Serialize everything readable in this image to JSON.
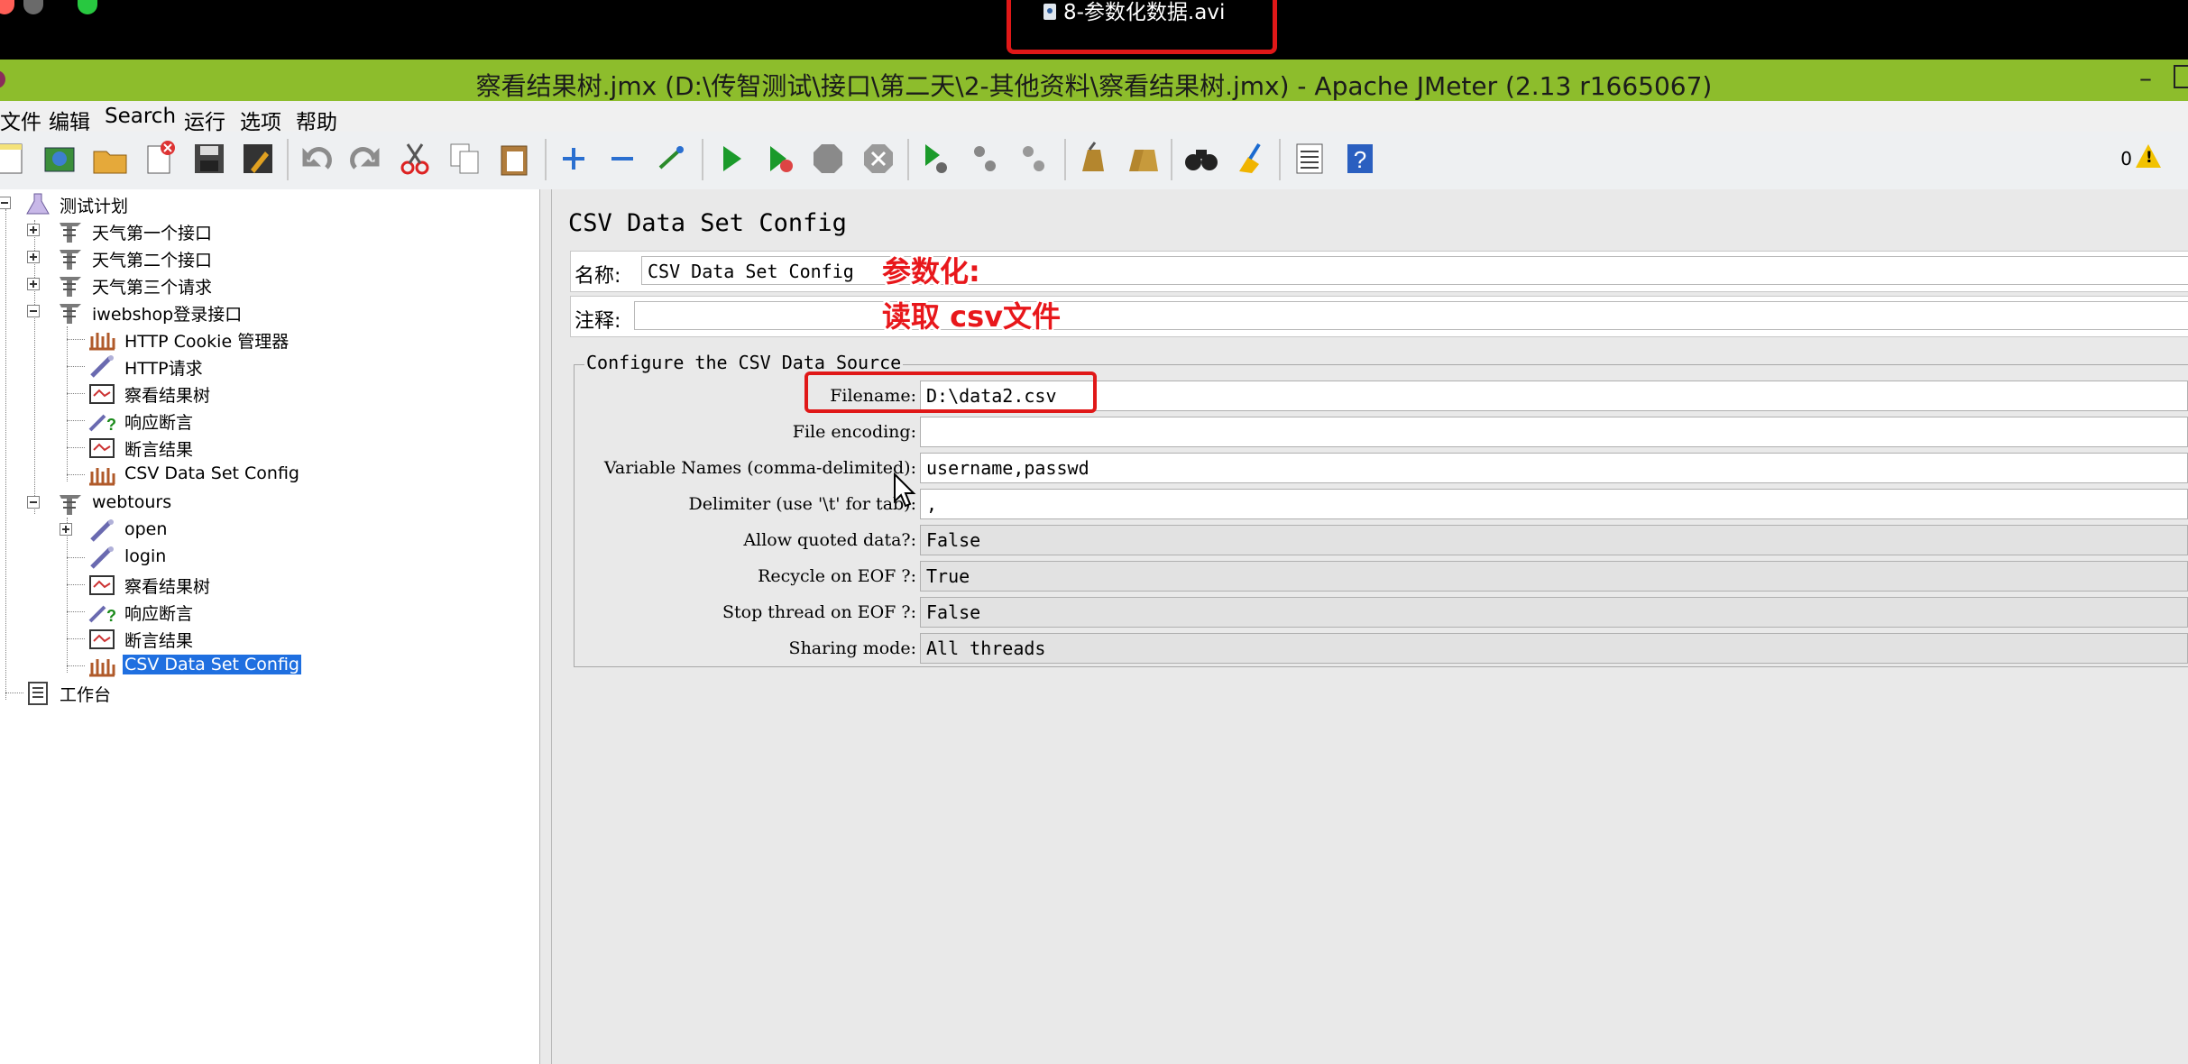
{
  "player": {
    "file_title": "8-参数化数据.avi"
  },
  "window": {
    "title": "察看结果树.jmx (D:\\传智测试\\接口\\第二天\\2-其他资料\\察看结果树.jmx) - Apache JMeter (2.13 r1665067)",
    "minimize": "–"
  },
  "menu": [
    "文件",
    "编辑",
    "Search",
    "运行",
    "选项",
    "帮助"
  ],
  "toolbar": {
    "icons": [
      "new-icon",
      "templates-icon",
      "open-icon",
      "close-icon",
      "save-icon",
      "save-as-icon",
      "undo-icon",
      "redo-icon",
      "cut-icon",
      "copy-icon",
      "paste-icon",
      "expand-icon",
      "collapse-icon",
      "toggle-icon",
      "start-icon",
      "start-no-pause-icon",
      "stop-icon",
      "shutdown-icon",
      "remote-start-icon",
      "remote-stop-icon",
      "remote-shutdown-icon",
      "clear-icon",
      "clear-all-icon",
      "search-icon",
      "reset-search-icon",
      "function-helper-icon",
      "help-icon"
    ],
    "warning_count": "0"
  },
  "tree": {
    "nodes": [
      {
        "label": "测试计划",
        "icon": "test-plan-icon"
      },
      {
        "label": "天气第一个接口",
        "icon": "thread-group-icon"
      },
      {
        "label": "天气第二个接口",
        "icon": "thread-group-icon"
      },
      {
        "label": "天气第三个请求",
        "icon": "thread-group-icon"
      },
      {
        "label": "iwebshop登录接口",
        "icon": "thread-group-icon"
      },
      {
        "label": "HTTP Cookie 管理器",
        "icon": "config-element-icon"
      },
      {
        "label": "HTTP请求",
        "icon": "sampler-icon"
      },
      {
        "label": "察看结果树",
        "icon": "listener-icon"
      },
      {
        "label": "响应断言",
        "icon": "assertion-icon"
      },
      {
        "label": "断言结果",
        "icon": "listener-icon"
      },
      {
        "label": "CSV Data Set Config",
        "icon": "config-element-icon"
      },
      {
        "label": "webtours",
        "icon": "thread-group-icon"
      },
      {
        "label": "open",
        "icon": "sampler-icon"
      },
      {
        "label": "login",
        "icon": "sampler-icon"
      },
      {
        "label": "察看结果树",
        "icon": "listener-icon"
      },
      {
        "label": "响应断言",
        "icon": "assertion-icon"
      },
      {
        "label": "断言结果",
        "icon": "listener-icon"
      },
      {
        "label": "CSV Data Set Config",
        "icon": "config-element-icon"
      },
      {
        "label": "工作台",
        "icon": "workbench-icon"
      }
    ],
    "selected": "CSV Data Set Config"
  },
  "config": {
    "panel_title": "CSV Data Set Config",
    "name_label": "名称:",
    "name_value": "CSV Data Set Config",
    "comment_label": "注释:",
    "comment_value": "",
    "group_title": "Configure the CSV Data Source",
    "rows": [
      {
        "label": "Filename:",
        "value": "D:\\data2.csv"
      },
      {
        "label": "File encoding:",
        "value": ""
      },
      {
        "label": "Variable Names (comma-delimited):",
        "value": "username,passwd"
      },
      {
        "label": "Delimiter (use '\\t' for tab):",
        "value": ","
      },
      {
        "label": "Allow quoted data?:",
        "value": "False"
      },
      {
        "label": "Recycle on EOF ?:",
        "value": "True"
      },
      {
        "label": "Stop thread on EOF ?:",
        "value": "False"
      },
      {
        "label": "Sharing mode:",
        "value": "All threads"
      }
    ]
  },
  "annotation": {
    "line1": "参数化:",
    "line2": "读取 csv文件",
    "color": "#e8171b"
  },
  "colors": {
    "title_bar": "#8dbd2c",
    "selection": "#1f6fe0",
    "highlight_box": "#e01818"
  }
}
